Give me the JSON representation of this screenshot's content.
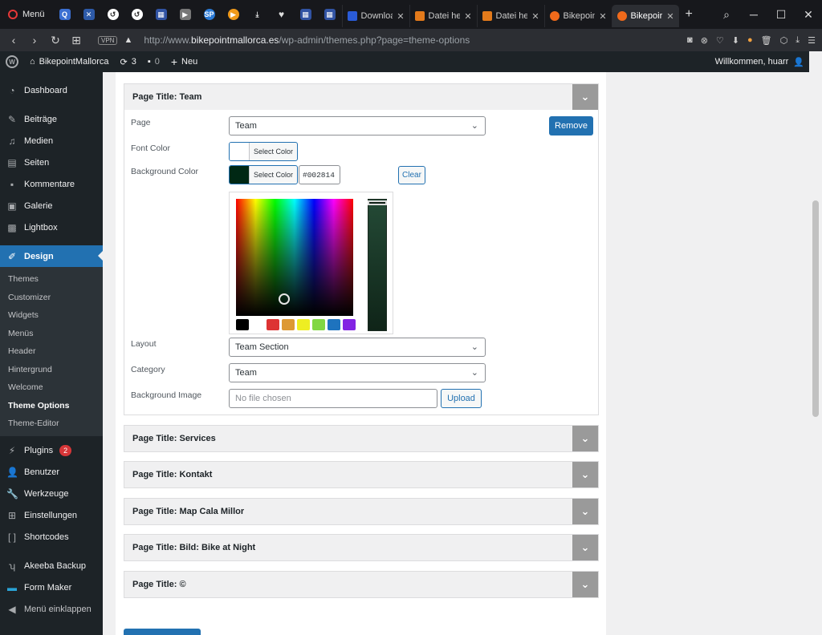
{
  "browser": {
    "menu_label": "Menü",
    "tabs": [
      {
        "label": "Downloac",
        "color": "#2a5bd7"
      },
      {
        "label": "Datei her",
        "color": "#e37a1b"
      },
      {
        "label": "Datei her",
        "color": "#e37a1b"
      },
      {
        "label": "Bikepoint",
        "color": "#f06a1b"
      },
      {
        "label": "Bikepoir",
        "color": "#f06a1b"
      }
    ],
    "url_prefix": "http://www.",
    "url_domain": "bikepointmallorca.es",
    "url_path": "/wp-admin/themes.php?page=theme-options",
    "vpn_label": "VPN"
  },
  "adminbar": {
    "site_name": "BikepointMallorca",
    "updates_count": "3",
    "comments_count": "0",
    "new_label": "Neu",
    "welcome": "Willkommen, huarr"
  },
  "sidebar": {
    "top_items": [
      {
        "label": "Dashboard",
        "icon": "dashboard-icon"
      },
      {
        "label": "Beiträge",
        "icon": "pin-icon"
      },
      {
        "label": "Medien",
        "icon": "media-icon"
      },
      {
        "label": "Seiten",
        "icon": "pages-icon"
      },
      {
        "label": "Kommentare",
        "icon": "comment-icon"
      },
      {
        "label": "Galerie",
        "icon": "gallery-icon"
      },
      {
        "label": "Lightbox",
        "icon": "lightbox-icon"
      }
    ],
    "current": "Design",
    "submenu": [
      "Themes",
      "Customizer",
      "Widgets",
      "Menüs",
      "Header",
      "Hintergrund",
      "Welcome",
      "Theme Options",
      "Theme-Editor"
    ],
    "current_sub": "Theme Options",
    "bottom_items": [
      {
        "label": "Plugins",
        "badge": "2"
      },
      {
        "label": "Benutzer"
      },
      {
        "label": "Werkzeuge"
      },
      {
        "label": "Einstellungen"
      },
      {
        "label": "Shortcodes"
      },
      {
        "label": "Akeeba Backup"
      },
      {
        "label": "Form Maker"
      },
      {
        "label": "Menü einklappen"
      }
    ]
  },
  "team": {
    "title": "Page Title: Team",
    "page_label": "Page",
    "page_value": "Team",
    "remove_label": "Remove",
    "font_color_label": "Font Color",
    "select_color": "Select Color",
    "bg_color_label": "Background Color",
    "bg_hex": "#002814",
    "clear_label": "Clear",
    "layout_label": "Layout",
    "layout_value": "Team Section",
    "category_label": "Category",
    "category_value": "Team",
    "bg_image_label": "Background Image",
    "no_file": "No file chosen",
    "upload_label": "Upload",
    "palette": [
      "#000000",
      "#ffffff",
      "#dd3333",
      "#dd9933",
      "#eeee22",
      "#81d742",
      "#1e73be",
      "#8224e3"
    ]
  },
  "sections": [
    "Page Title: Services",
    "Page Title: Kontakt",
    "Page Title: Map Cala Millor",
    "Page Title: Bild: Bike at Night",
    "Page Title: ©"
  ]
}
